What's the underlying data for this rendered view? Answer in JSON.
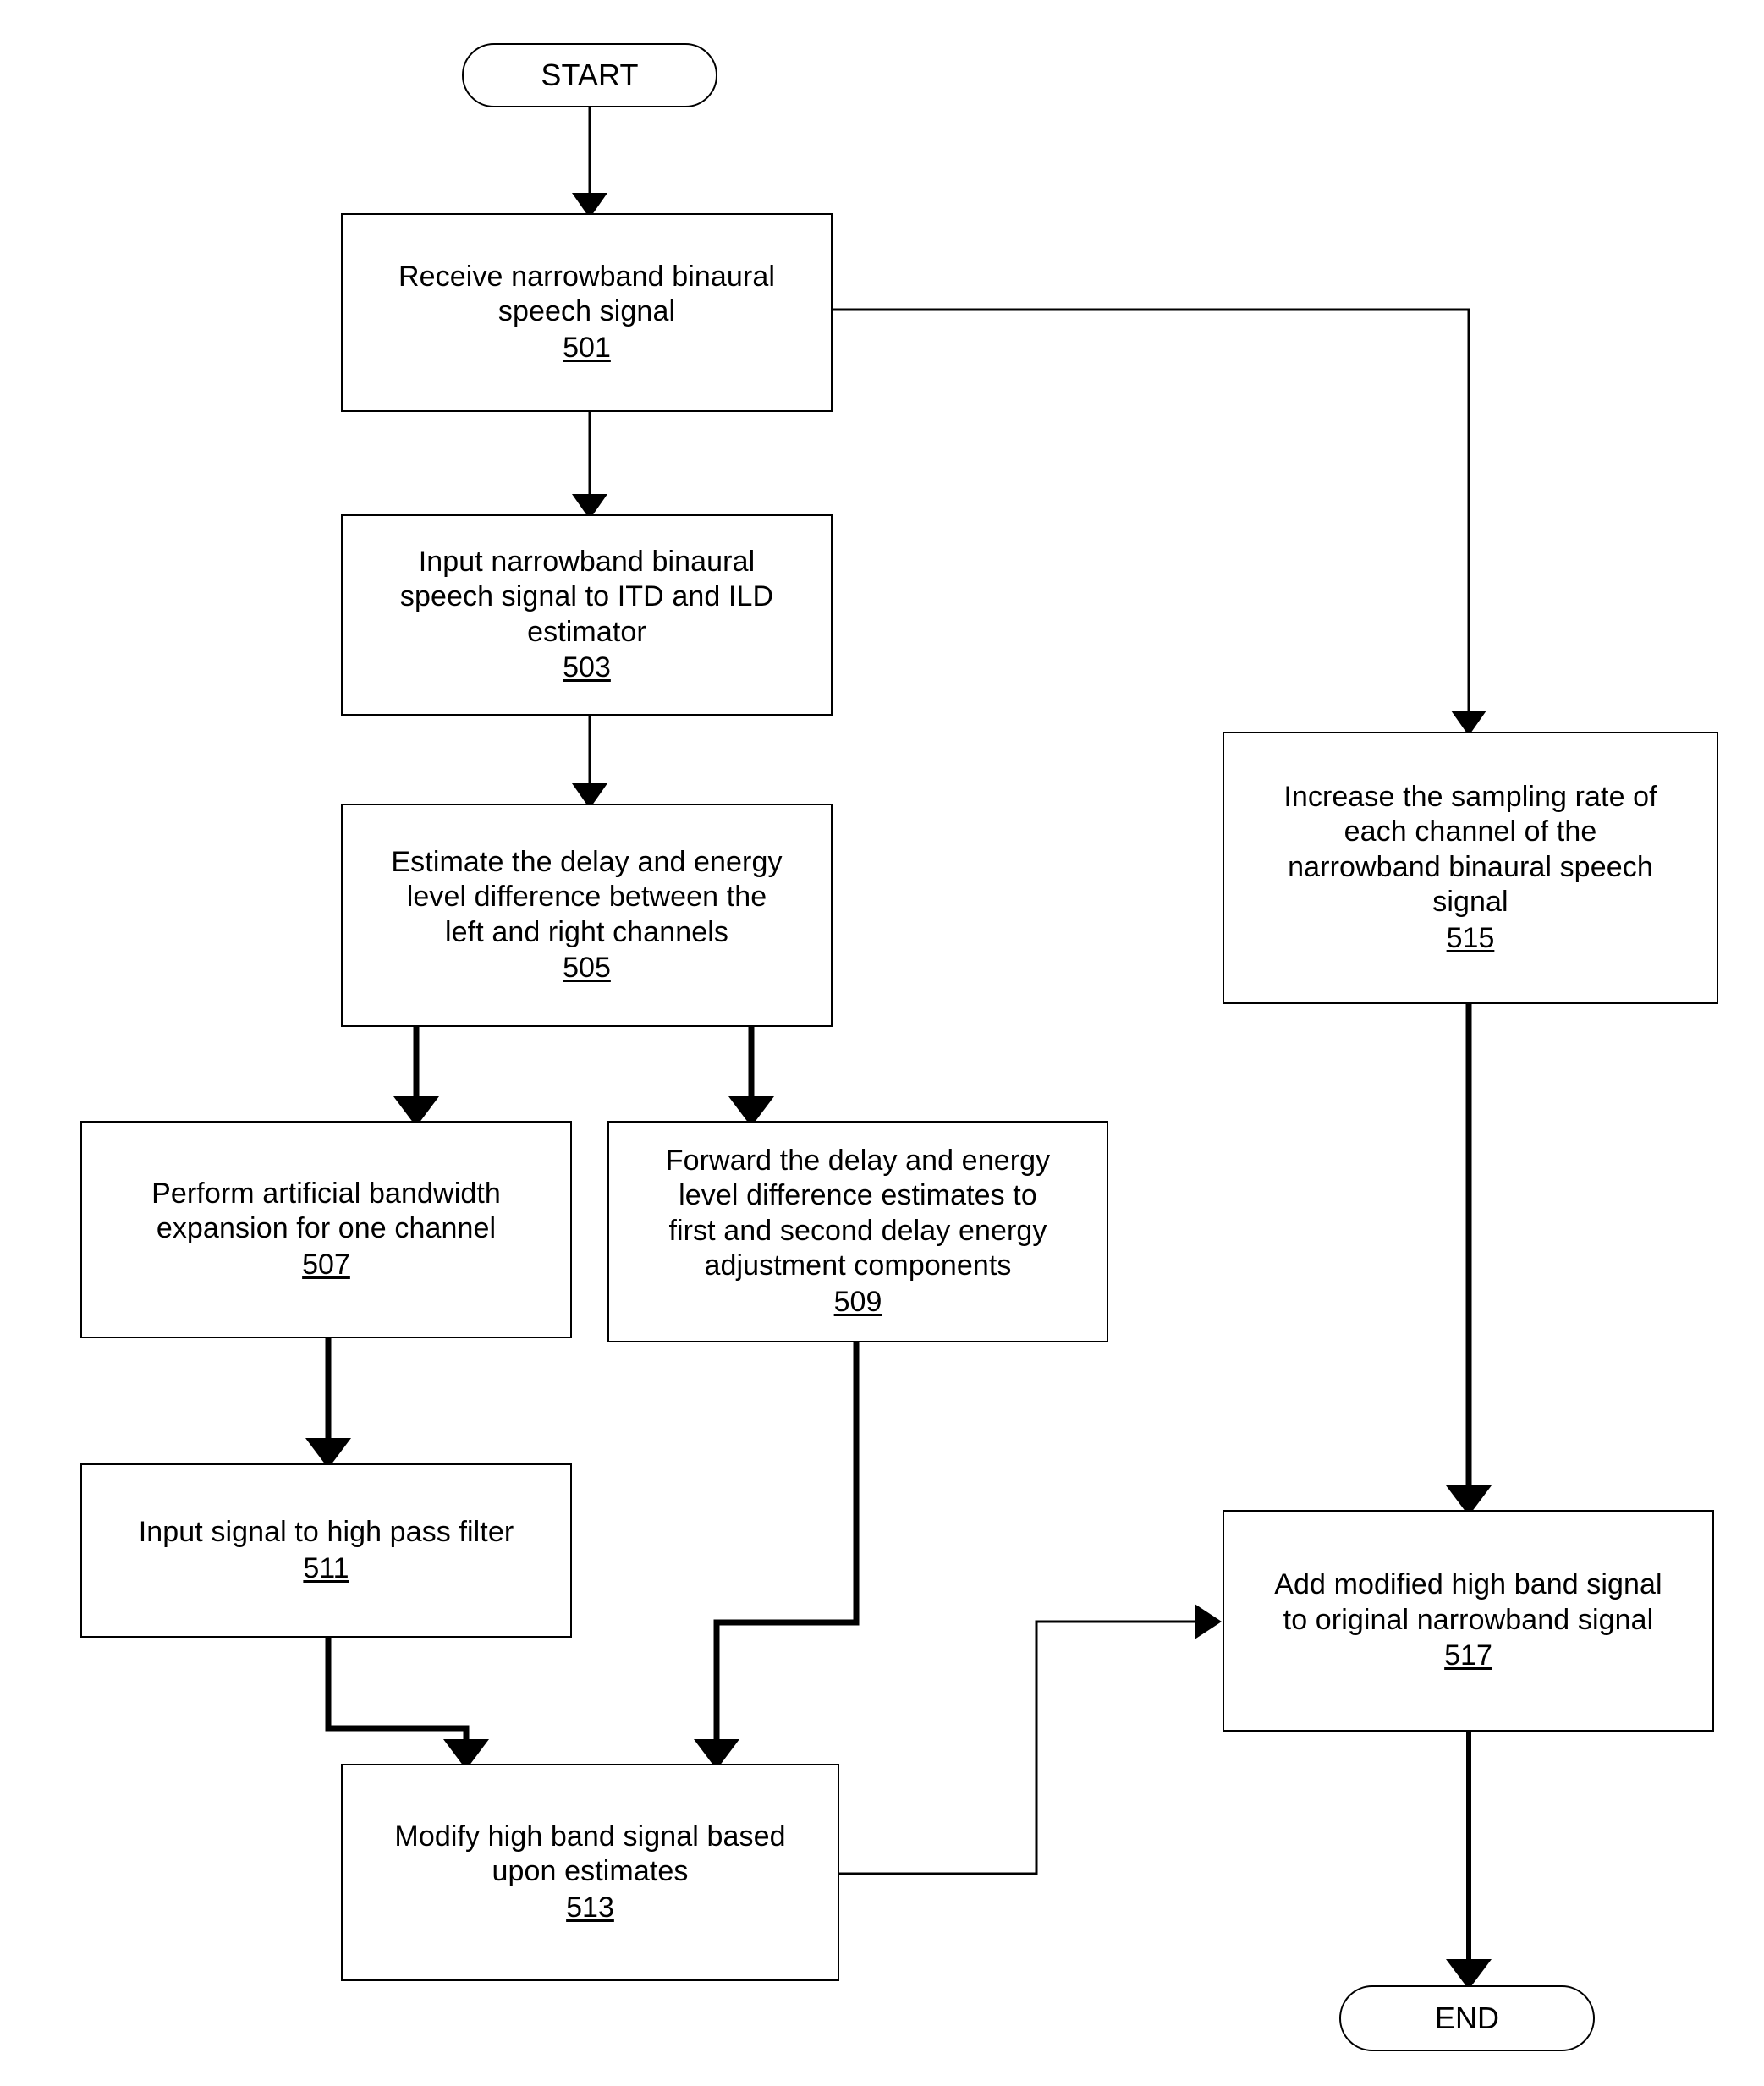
{
  "figure": {
    "type": "flowchart",
    "orientation": "top-to-bottom",
    "background_color": "#ffffff",
    "line_color": "#000000"
  },
  "nodes": {
    "start": {
      "label": "START",
      "shape": "terminal"
    },
    "n501": {
      "label": "Receive narrowband binaural\nspeech signal",
      "ref": "501",
      "shape": "process"
    },
    "n503": {
      "label": "Input narrowband binaural\nspeech signal to ITD and ILD\nestimator",
      "ref": "503",
      "shape": "process"
    },
    "n505": {
      "label": "Estimate the delay and energy\nlevel difference between the\nleft and right channels",
      "ref": "505",
      "shape": "process"
    },
    "n507": {
      "label": "Perform artificial bandwidth\nexpansion for one channel",
      "ref": "507",
      "shape": "process"
    },
    "n509": {
      "label": "Forward the delay and energy\nlevel difference estimates to\nfirst and second delay energy\nadjustment components",
      "ref": "509",
      "shape": "process"
    },
    "n511": {
      "label": "Input signal to high pass filter",
      "ref": "511",
      "shape": "process"
    },
    "n513": {
      "label": "Modify high band signal based\nupon estimates",
      "ref": "513",
      "shape": "process"
    },
    "n515": {
      "label": "Increase the sampling rate of\neach channel of the\nnarrowband binaural speech\nsignal",
      "ref": "515",
      "shape": "process"
    },
    "n517": {
      "label": "Add modified high band signal\nto original narrowband signal",
      "ref": "517",
      "shape": "process"
    },
    "end": {
      "label": "END",
      "shape": "terminal"
    }
  },
  "edges": [
    {
      "from": "start",
      "to": "n501",
      "style": "thin"
    },
    {
      "from": "n501",
      "to": "n503",
      "style": "thin"
    },
    {
      "from": "n501",
      "to": "n515",
      "style": "thin"
    },
    {
      "from": "n503",
      "to": "n505",
      "style": "thin"
    },
    {
      "from": "n505",
      "to": "n507",
      "style": "thick"
    },
    {
      "from": "n505",
      "to": "n509",
      "style": "thick"
    },
    {
      "from": "n507",
      "to": "n511",
      "style": "thick"
    },
    {
      "from": "n509",
      "to": "n513",
      "style": "thick"
    },
    {
      "from": "n511",
      "to": "n513",
      "style": "thick"
    },
    {
      "from": "n513",
      "to": "n517",
      "style": "thin"
    },
    {
      "from": "n515",
      "to": "n517",
      "style": "thick"
    },
    {
      "from": "n517",
      "to": "end",
      "style": "thick"
    }
  ]
}
